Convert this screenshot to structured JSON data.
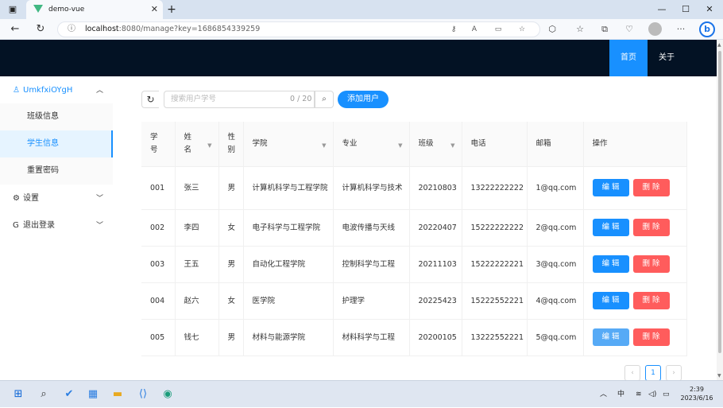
{
  "browser": {
    "tab_title": "demo-vue",
    "new_tab": "+",
    "url_host": "localhost",
    "url_path": ":8080/manage?key=1686854339259",
    "minimize": "—",
    "maximize": "☐",
    "close": "✕"
  },
  "topnav": {
    "home": "首页",
    "about": "关于"
  },
  "sidebar": {
    "user_menu": "UmkfxiOYgH",
    "items": [
      {
        "label": "班级信息"
      },
      {
        "label": "学生信息"
      },
      {
        "label": "重置密码"
      }
    ],
    "settings": "设置",
    "logout": "退出登录"
  },
  "toolbar": {
    "search_placeholder": "搜索用户学号",
    "search_count": "0 / 20",
    "add_label": "添加用户"
  },
  "table": {
    "headers": {
      "id_a": "学",
      "id_b": "号",
      "name_a": "姓",
      "name_b": "名",
      "gender_a": "性",
      "gender_b": "别",
      "college": "学院",
      "major": "专业",
      "class": "班级",
      "phone": "电话",
      "email": "邮箱",
      "actions": "操作"
    },
    "edit_label": "编 辑",
    "delete_label": "删 除",
    "rows": [
      {
        "id": "001",
        "name": "张三",
        "gender": "男",
        "college": "计算机科学与工程学院",
        "major": "计算机科学与技术",
        "class": "20210803",
        "phone": "13222222222",
        "email": "1@qq.com"
      },
      {
        "id": "002",
        "name": "李四",
        "gender": "女",
        "college": "电子科学与工程学院",
        "major": "电波传播与天线",
        "class": "20220407",
        "phone": "15222222222",
        "email": "2@qq.com"
      },
      {
        "id": "003",
        "name": "王五",
        "gender": "男",
        "college": "自动化工程学院",
        "major": "控制科学与工程",
        "class": "20211103",
        "phone": "15222222221",
        "email": "3@qq.com"
      },
      {
        "id": "004",
        "name": "赵六",
        "gender": "女",
        "college": "医学院",
        "major": "护理学",
        "class": "20225423",
        "phone": "15222552221",
        "email": "4@qq.com"
      },
      {
        "id": "005",
        "name": "钱七",
        "gender": "男",
        "college": "材料与能源学院",
        "major": "材料科学与工程",
        "class": "20200105",
        "phone": "13222552221",
        "email": "5@qq.com"
      }
    ]
  },
  "pagination": {
    "prev": "‹",
    "current": "1",
    "next": "›"
  },
  "taskbar": {
    "lang": "中",
    "time": "2:39",
    "date": "2023/6/16"
  },
  "colors": {
    "primary": "#1890ff",
    "danger": "#ff5c5c",
    "header_bg": "#031224"
  }
}
